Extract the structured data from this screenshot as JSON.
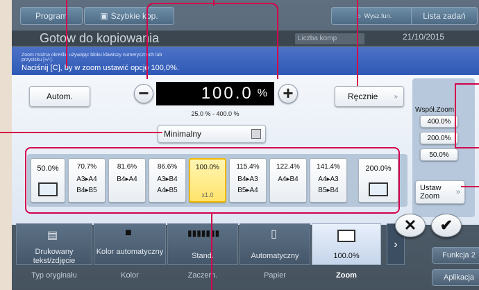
{
  "top_bar": {
    "program_label": "Program",
    "quick_copy_label": "Szybkie kop.",
    "search_label": "Wysz.fun.",
    "jobs_label": "Lista zadań"
  },
  "status": {
    "title": "Gotow do kopiowania",
    "copies_label": "Liczba komp",
    "date": "21/10/2015"
  },
  "dialog": {
    "header_small": "Zoom można określić używając bloku klawiszy numerycznych lub przycisku [+/-].",
    "header_main": "Naciśnij [C], by w zoom ustawić opcję 100,0%.",
    "auto_label": "Autom.",
    "value": "100.0",
    "unit": "%",
    "minus": "−",
    "plus": "+",
    "range": "25.0 % - 400.0 %",
    "manual_label": "Ręcznie",
    "minimal_label": "Minimalny",
    "presets": [
      {
        "pct": "50.0%"
      },
      {
        "pct": "70.7%",
        "l1": "A3▸A4",
        "l2": "B4▸B5"
      },
      {
        "pct": "81.6%",
        "l1": "B4▸A4",
        "l2": ""
      },
      {
        "pct": "86.6%",
        "l1": "A3▸B4",
        "l2": "A4▸B5"
      },
      {
        "pct": "100.0%",
        "l1": "",
        "l2": "x1.0"
      },
      {
        "pct": "115.4%",
        "l1": "B4▸A3",
        "l2": "B5▸A4"
      },
      {
        "pct": "122.4%",
        "l1": "A4▸B4",
        "l2": ""
      },
      {
        "pct": "141.4%",
        "l1": "A4▸A3",
        "l2": "B5▸B4"
      },
      {
        "pct": "200.0%"
      }
    ],
    "shared_zoom_title": "Współ.Zoom",
    "shared_zoom_values": [
      "400.0%",
      "200.0%",
      "50.0%"
    ],
    "set_zoom_label_1": "Ustaw",
    "set_zoom_label_2": "Zoom"
  },
  "bottom": {
    "tiles": [
      {
        "value": "Drukowany tekst/zdjęcie",
        "label": "Typ oryginału"
      },
      {
        "value": "Kolor automatyczny",
        "label": "Kolor"
      },
      {
        "value": "Stand.",
        "label": "Zaczern."
      },
      {
        "value": "Automatyczny",
        "label": "Papier"
      },
      {
        "value": "100.0%",
        "label": "Zoom"
      }
    ],
    "function2_label": "Funkcja 2",
    "app_label": "Aplikacja",
    "cancel_symbol": "✕",
    "ok_symbol": "✔"
  },
  "colors": {
    "accent": "#d4004b",
    "header": "#3a62bd",
    "selected": "#ffe36b"
  }
}
